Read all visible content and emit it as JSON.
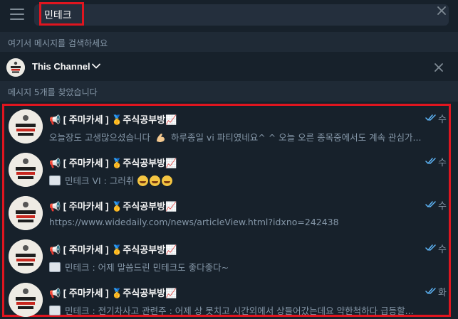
{
  "search": {
    "value": "민테크",
    "hint": "여기서 메시지를 검색하세요"
  },
  "channel": {
    "name": "This Channel"
  },
  "results_header": "메시지 5개를 찾았습니다",
  "results": [
    {
      "title_prefix": "📢 [ 주마카세 ]",
      "title_suffix": "주식공부방",
      "date": "수",
      "snippet_a": "오늘장도 고생많으셨습니다",
      "snippet_b": "하루종일 vi 파티였네요^ ^ 오늘 오른 종목중에서도 계속 관심가..."
    },
    {
      "title_prefix": "📢 [ 주마카세 ]",
      "title_suffix": "주식공부방",
      "date": "수",
      "snippet_a": "민테크 VI : 그러취"
    },
    {
      "title_prefix": "📢 [ 주마카세 ]",
      "title_suffix": "주식공부방",
      "date": "수",
      "snippet_a": "https://www.widedaily.com/news/articleView.html?idxno=242438"
    },
    {
      "title_prefix": "📢 [ 주마카세 ]",
      "title_suffix": "주식공부방",
      "date": "수",
      "snippet_a": "민테크 : 어제 말씀드린 민테크도 좋다좋다~"
    },
    {
      "title_prefix": "📢 [ 주마카세 ]",
      "title_suffix": "주식공부방",
      "date": "화",
      "snippet_a": "민테크 : 전기차사고 관련주 : 어제 상 못치고 시간외에서 상들어갔는데요 약한척하다 급등할..."
    }
  ],
  "colors": {
    "background": "#17212b",
    "search_bg": "#242f3d",
    "muted_text": "#8597a8",
    "highlight_border": "#e0151f",
    "read_ticks": "#5eb5f7"
  },
  "icons": {
    "menu": "hamburger-menu-icon",
    "clear": "close-icon",
    "chevron": "chevron-down-icon",
    "read": "double-check-icon"
  }
}
